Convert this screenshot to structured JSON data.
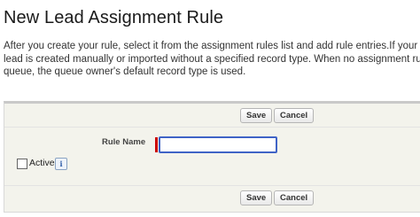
{
  "page": {
    "title": "New Lead Assignment Rule",
    "description_lines": [
      "After you create your rule, select it from the assignment rules list and add rule entries.If your orga",
      "lead is created manually or imported without a specified record type. When no assignment rules a",
      "queue, the queue owner's default record type is used."
    ]
  },
  "form": {
    "buttons": {
      "save": "Save",
      "cancel": "Cancel"
    },
    "rule_name": {
      "label": "Rule Name",
      "value": ""
    },
    "active": {
      "label": "Active",
      "checked": false,
      "info_icon": "info-icon",
      "info_glyph": "i"
    }
  },
  "colors": {
    "required": "#cc0000",
    "focus_border": "#3f63c6",
    "panel_bg": "#f3f3ec"
  }
}
